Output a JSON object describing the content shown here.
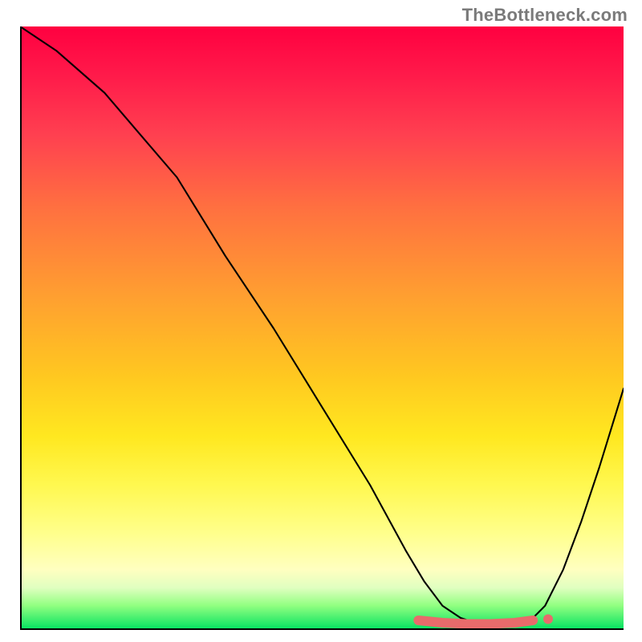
{
  "watermark": "TheBottleneck.com",
  "chart_data": {
    "type": "line",
    "title": "",
    "xlabel": "",
    "ylabel": "",
    "xlim": [
      0,
      100
    ],
    "ylim": [
      0,
      100
    ],
    "grid": false,
    "legend": false,
    "series": [
      {
        "name": "bottleneck-curve",
        "x": [
          0,
          6,
          14,
          20,
          26,
          34,
          42,
          50,
          58,
          64,
          67,
          70,
          73,
          76,
          80,
          84,
          87,
          90,
          93,
          96,
          100
        ],
        "y": [
          100,
          96,
          89,
          82,
          75,
          62,
          50,
          37,
          24,
          13,
          8,
          4,
          2,
          1,
          0.5,
          1,
          4,
          10,
          18,
          27,
          40
        ]
      }
    ],
    "highlight_segment": {
      "name": "optimal-range",
      "x": [
        66,
        70,
        74,
        78,
        82,
        85
      ],
      "y": [
        1.6,
        1.2,
        1.0,
        1.0,
        1.2,
        1.6
      ]
    },
    "highlight_point": {
      "x": 87.5,
      "y": 1.8
    },
    "background_gradient": {
      "stops": [
        {
          "pos": 0,
          "color": "#ff0040"
        },
        {
          "pos": 18,
          "color": "#ff4050"
        },
        {
          "pos": 45,
          "color": "#ffa030"
        },
        {
          "pos": 68,
          "color": "#ffe820"
        },
        {
          "pos": 90,
          "color": "#ffffc0"
        },
        {
          "pos": 100,
          "color": "#00e060"
        }
      ]
    }
  }
}
